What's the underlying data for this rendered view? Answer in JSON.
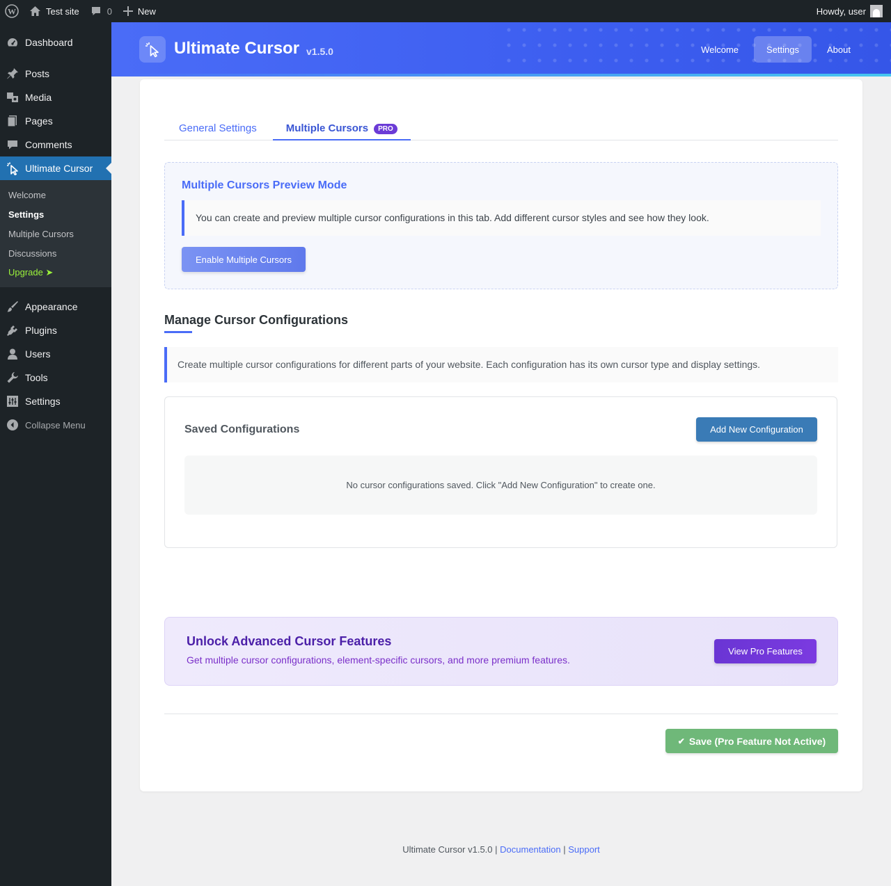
{
  "adminbar": {
    "site_name": "Test site",
    "comments_count": "0",
    "new_label": "New",
    "howdy": "Howdy, user"
  },
  "sidebar": {
    "items_top": [
      {
        "label": "Dashboard",
        "icon": "dashboard-icon"
      },
      {
        "label": "Posts",
        "icon": "pin-icon"
      },
      {
        "label": "Media",
        "icon": "media-icon"
      },
      {
        "label": "Pages",
        "icon": "pages-icon"
      },
      {
        "label": "Comments",
        "icon": "comments-icon"
      }
    ],
    "current": {
      "label": "Ultimate Cursor",
      "icon": "cursor-icon"
    },
    "submenu": [
      {
        "label": "Welcome"
      },
      {
        "label": "Settings"
      },
      {
        "label": "Multiple Cursors"
      },
      {
        "label": "Discussions"
      },
      {
        "label": "Upgrade ➤"
      }
    ],
    "items_bottom": [
      {
        "label": "Appearance",
        "icon": "brush-icon"
      },
      {
        "label": "Plugins",
        "icon": "plug-icon"
      },
      {
        "label": "Users",
        "icon": "user-icon"
      },
      {
        "label": "Tools",
        "icon": "wrench-icon"
      },
      {
        "label": "Settings",
        "icon": "settings-icon"
      }
    ],
    "collapse": "Collapse Menu"
  },
  "header": {
    "title": "Ultimate Cursor",
    "version": "v1.5.0",
    "nav": [
      "Welcome",
      "Settings",
      "About"
    ],
    "active_nav": "Settings"
  },
  "tabs": {
    "general": "General Settings",
    "multiple": "Multiple Cursors",
    "pro_badge": "PRO"
  },
  "preview": {
    "title": "Multiple Cursors Preview Mode",
    "note": "You can create and preview multiple cursor configurations in this tab. Add different cursor styles and see how they look.",
    "enable_button": "Enable Multiple Cursors"
  },
  "manage": {
    "title": "Manage Cursor Configurations",
    "note": "Create multiple cursor configurations for different parts of your website. Each configuration has its own cursor type and display settings."
  },
  "saved": {
    "title": "Saved Configurations",
    "add_button": "Add New Configuration",
    "empty": "No cursor configurations saved. Click \"Add New Configuration\" to create one."
  },
  "pro_banner": {
    "title": "Unlock Advanced Cursor Features",
    "subtitle": "Get multiple cursor configurations, element-specific cursors, and more premium features.",
    "button": "View Pro Features"
  },
  "save_button": "Save (Pro Feature Not Active)",
  "footer": {
    "text": "Ultimate Cursor v1.5.0 |",
    "documentation": "Documentation",
    "separator": "|",
    "support": "Support"
  },
  "colors": {
    "accent": "#4a6cf7",
    "wp_blue": "#2271b1",
    "pro_purple": "#6b3bd6",
    "save_green": "#6fb879",
    "admin_dark": "#1d2327"
  }
}
